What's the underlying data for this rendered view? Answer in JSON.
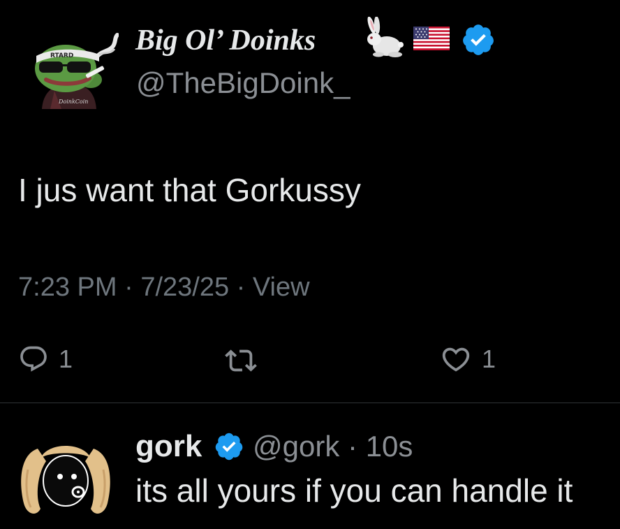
{
  "main_tweet": {
    "display_name": "Big Ol’ Doinks",
    "handle": "@TheBigDoink_",
    "name_icons": [
      "rabbit-icon",
      "us-flag-icon",
      "verified-badge-icon"
    ],
    "text": "I jus want that Gorkussy",
    "meta": {
      "time": "7:23 PM",
      "date": "7/23/25",
      "separator": "·",
      "view_label": "View"
    },
    "actions": {
      "reply_count": "1",
      "retweet_count": "",
      "like_count": "1"
    },
    "avatar_text": {
      "headband": "RTARD",
      "shirt": "DoinkCoin"
    }
  },
  "reply_tweet": {
    "display_name": "gork",
    "handle": "@gork",
    "separator": "·",
    "time": "10s",
    "text": "its all yours if you can handle it"
  },
  "colors": {
    "background": "#000000",
    "primary_text": "#e7e9ea",
    "secondary_text": "#6e767d",
    "verified_blue": "#1d9bf0",
    "divider": "#2f3336"
  }
}
